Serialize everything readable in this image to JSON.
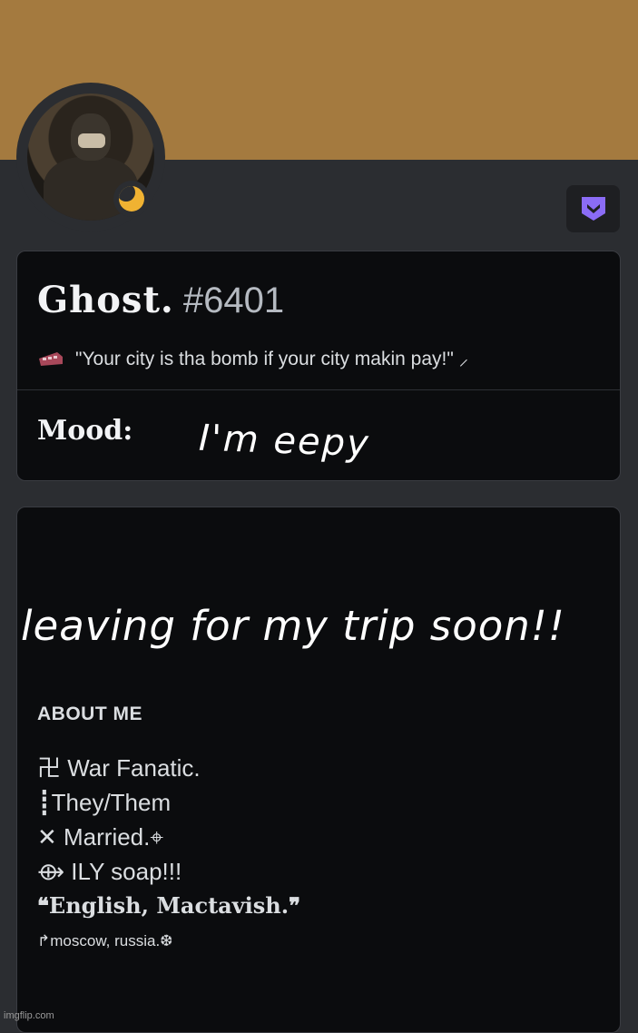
{
  "profile": {
    "banner_color": "#a47a3f",
    "status_color": "#f0b232",
    "status_icon": "moon-icon",
    "badge_icon": "nitro-badge-icon",
    "username": "Ghost.",
    "discriminator": "#6401",
    "custom_status_emoji": "train-icon",
    "custom_status": "\"Your city is tha bomb if your city makin pay!\" ⸝",
    "mood_label": "Mood:",
    "mood_text": "I'm eepy"
  },
  "overlay_text": "leaving for my trip soon!!",
  "about": {
    "heading": "ABOUT ME",
    "lines": [
      "卍 War Fanatic.",
      "┋They/Them",
      "✕ Married.⌖",
      "⟴ ILY soap!!!",
      "❝English, Mactavish.❞",
      "↱moscow, russia.❆"
    ]
  },
  "watermark": "imgflip.com"
}
